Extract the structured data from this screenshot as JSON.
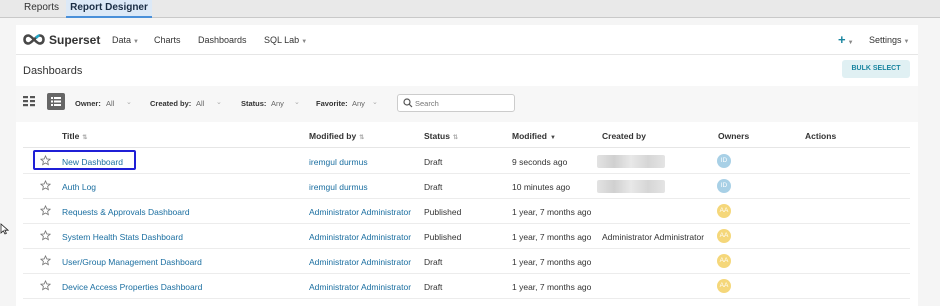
{
  "outer_tabs": [
    "Reports",
    "Report Designer"
  ],
  "navbar": {
    "brand": "Superset",
    "items": [
      "Data",
      "Charts",
      "Dashboards",
      "SQL Lab"
    ],
    "plus": "+",
    "settings": "Settings"
  },
  "subheader": {
    "title": "Dashboards",
    "bulk_select": "BULK SELECT"
  },
  "filters": {
    "owner_label": "Owner:",
    "owner_value": "All",
    "created_by_label": "Created by:",
    "created_by_value": "All",
    "status_label": "Status:",
    "status_value": "Any",
    "favorite_label": "Favorite:",
    "favorite_value": "Any",
    "search_placeholder": "Search"
  },
  "table": {
    "columns": [
      "Title",
      "Modified by",
      "Status",
      "Modified",
      "Created by",
      "Owners",
      "Actions"
    ],
    "rows": [
      {
        "title": "New Dashboard",
        "modified_by": "iremgul durmus",
        "status": "Draft",
        "modified": "9 seconds ago",
        "created_by": "",
        "owner_initials": "ID",
        "owner_color": "#a8d0e6"
      },
      {
        "title": "Auth Log",
        "modified_by": "iremgul durmus",
        "status": "Draft",
        "modified": "10 minutes ago",
        "created_by": "",
        "owner_initials": "ID",
        "owner_color": "#a8d0e6"
      },
      {
        "title": "Requests & Approvals Dashboard",
        "modified_by": "Administrator Administrator",
        "status": "Published",
        "modified": "1 year, 7 months ago",
        "created_by": "",
        "owner_initials": "AA",
        "owner_color": "#f5d77a"
      },
      {
        "title": "System Health Stats Dashboard",
        "modified_by": "Administrator Administrator",
        "status": "Published",
        "modified": "1 year, 7 months ago",
        "created_by": "Administrator Administrator",
        "owner_initials": "AA",
        "owner_color": "#f5d77a"
      },
      {
        "title": "User/Group Management Dashboard",
        "modified_by": "Administrator Administrator",
        "status": "Draft",
        "modified": "1 year, 7 months ago",
        "created_by": "",
        "owner_initials": "AA",
        "owner_color": "#f5d77a"
      },
      {
        "title": "Device Access Properties Dashboard",
        "modified_by": "Administrator Administrator",
        "status": "Draft",
        "modified": "1 year, 7 months ago",
        "created_by": "",
        "owner_initials": "AA",
        "owner_color": "#f5d77a"
      }
    ]
  },
  "colors": {
    "accent": "#1a85a0",
    "link": "#1a6ea0",
    "highlight": "#1f1fd6"
  }
}
